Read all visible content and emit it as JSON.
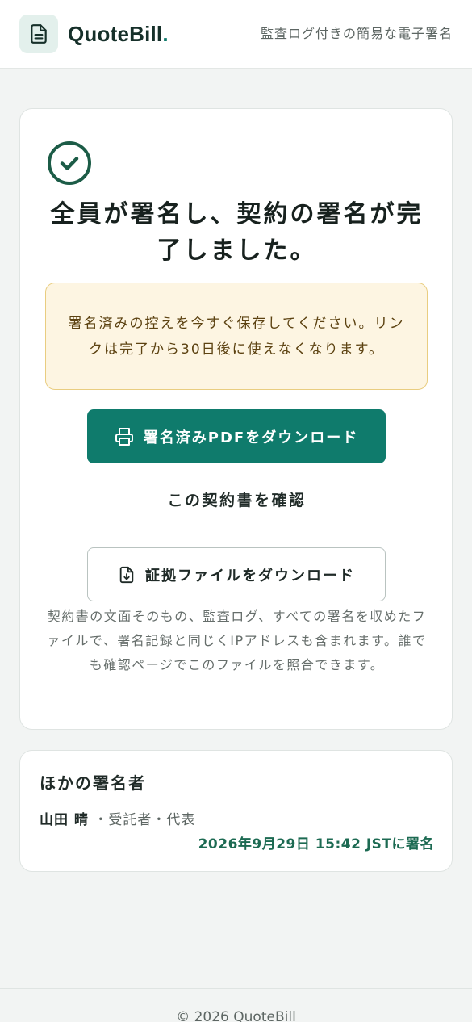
{
  "header": {
    "brand_name": "QuoteBill",
    "brand_dot": ".",
    "tagline": "監査ログ付きの簡易な電子署名",
    "logo_icon": "document-icon"
  },
  "completion": {
    "icon": "check-circle-icon",
    "title": "全員が署名し、契約の署名が完了しました。",
    "notice": "署名済みの控えを今すぐ保存してください。リンクは完了から30日後に使えなくなります。",
    "download_pdf_label": "署名済みPDFをダウンロード",
    "verify_link_label": "この契約書を確認",
    "download_evidence_label": "証拠ファイルをダウンロード",
    "evidence_description": "契約書の文面そのもの、監査ログ、すべての署名を収めたファイルで、署名記録と同じくIPアドレスも含まれます。誰でも確認ページでこのファイルを照合できます。"
  },
  "other_signers": {
    "heading": "ほかの署名者",
    "signers": [
      {
        "name": "山田 晴",
        "role": "・受託者・代表",
        "signed_at": "2026年9月29日 15:42 JST",
        "signed_suffix": "に署名"
      }
    ]
  },
  "footer": {
    "copyright": "© 2026 QuoteBill"
  },
  "colors": {
    "accent": "#0f7b6c",
    "notice_bg": "#fdf5e2",
    "notice_border": "#e9cd80",
    "signed_text": "#1c6a52"
  }
}
